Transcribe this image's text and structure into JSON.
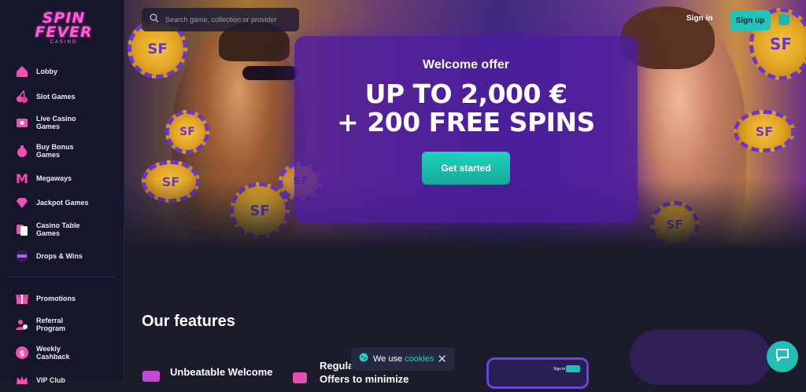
{
  "brand": {
    "line1": "SPIN",
    "line2": "FEVER",
    "line3": "CASINO"
  },
  "search": {
    "placeholder": "Search game, collection or provider"
  },
  "header": {
    "signin_label": "Sign in",
    "signup_label": "Sign up"
  },
  "sidebar": {
    "items": [
      {
        "label": "Lobby",
        "icon": "home-icon"
      },
      {
        "label": "Slot Games",
        "icon": "cherry-icon"
      },
      {
        "label": "Live Casino Games",
        "icon": "live-casino-icon"
      },
      {
        "label": "Buy Bonus Games",
        "icon": "money-bag-icon"
      },
      {
        "label": "Megaways",
        "icon": "megaways-icon"
      },
      {
        "label": "Jackpot Games",
        "icon": "diamond-icon"
      },
      {
        "label": "Casino Table Games",
        "icon": "cards-icon"
      },
      {
        "label": "Drops & Wins",
        "icon": "drops-wins-icon"
      }
    ],
    "secondary": [
      {
        "label": "Promotions",
        "icon": "gift-icon"
      },
      {
        "label": "Referral Program",
        "icon": "referral-icon"
      },
      {
        "label": "Weekly Cashback",
        "icon": "cashback-icon"
      },
      {
        "label": "VIP Club",
        "icon": "vip-icon"
      }
    ]
  },
  "hero": {
    "welcome": "Welcome offer",
    "line1": "UP TO 2,000 €",
    "line2": "+ 200 FREE SPINS",
    "cta_label": "Get started",
    "chip_text": "SF"
  },
  "features": {
    "title": "Our features",
    "item1": "Unbeatable Welcome",
    "item2_line1": "Regular",
    "item2_line2": "Offers to minimize",
    "phone_text": "Sign in"
  },
  "cookie": {
    "prefix": "We use",
    "link": "cookies"
  },
  "colors": {
    "accent": "#22c3b8",
    "pink": "#ff5fd2",
    "purple": "#4e1ca0",
    "bg": "#1a1b2b"
  }
}
